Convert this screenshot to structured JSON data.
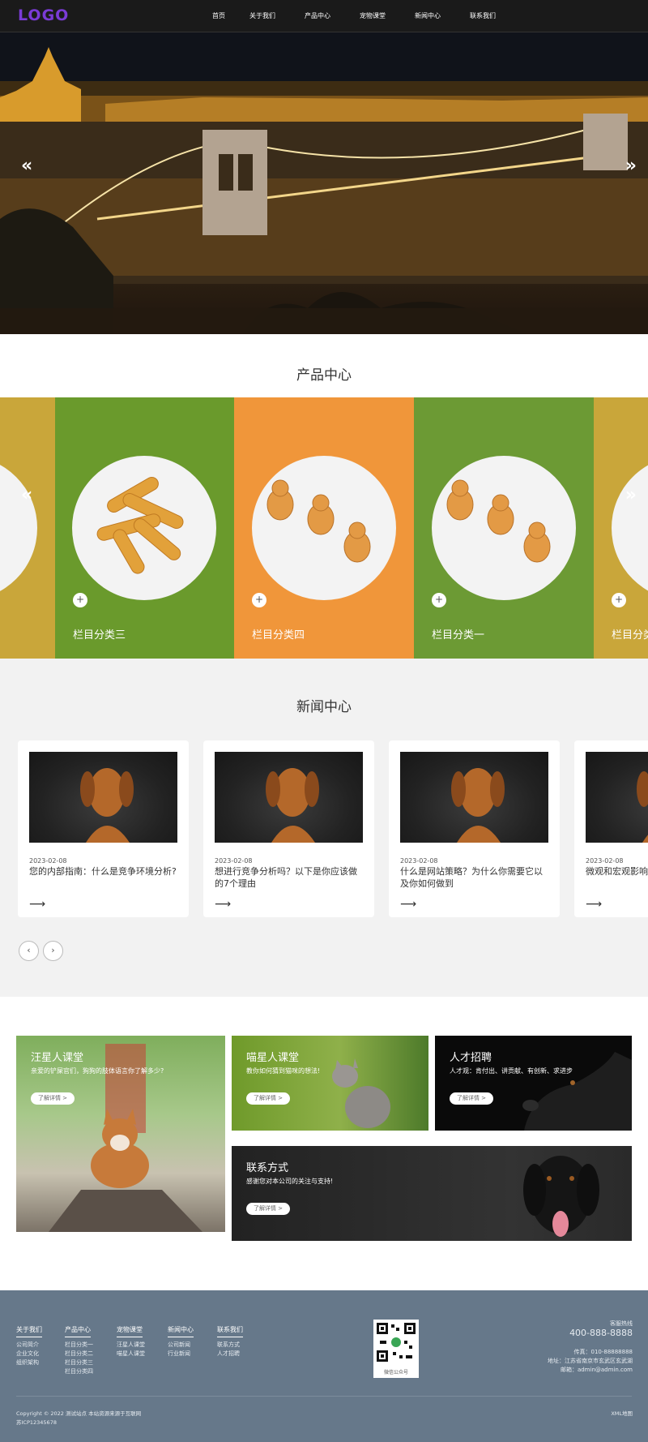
{
  "header": {
    "logo": "LOGO",
    "nav": [
      "首页",
      "关于我们",
      "产品中心",
      "宠物课堂",
      "新闻中心",
      "联系我们"
    ]
  },
  "hero": {
    "prev_icon": "«",
    "next_icon": "»"
  },
  "products": {
    "title": "产品中心",
    "prev_icon": "«",
    "next_icon": "»",
    "plus_icon": "+",
    "items": [
      {
        "label": "栏目分类三",
        "color": "#6a9a2c"
      },
      {
        "label": "栏目分类四",
        "color": "#f0963a"
      },
      {
        "label": "栏目分类一",
        "color": "#6c9a34"
      },
      {
        "label": "栏目分类二",
        "color": "#c9a63a"
      }
    ]
  },
  "news": {
    "title": "新闻中心",
    "arrow": "⟶",
    "prev": "‹",
    "next": "›",
    "items": [
      {
        "date": "2023-02-08",
        "title": "您的内部指南：什么是竞争环境分析?"
      },
      {
        "date": "2023-02-08",
        "title": "想进行竞争分析吗？以下是你应该做的7个理由"
      },
      {
        "date": "2023-02-08",
        "title": "什么是网站策略？为什么你需要它以及你如何做到"
      },
      {
        "date": "2023-02-08",
        "title": "微观和宏观影响"
      }
    ]
  },
  "banners": {
    "dog_class": {
      "title": "汪星人课堂",
      "desc": "亲爱的铲屎官们，狗狗的肢体语言你了解多少?",
      "button": "了解详情 >"
    },
    "cat_class": {
      "title": "喵星人课堂",
      "desc": "教你如何猜到猫咪的想法!",
      "button": "了解详情 >"
    },
    "jobs": {
      "title": "人才招聘",
      "desc": "人才观：肯付出、讲贡献、有创新、求进步",
      "button": "了解详情 >"
    },
    "contact": {
      "title": "联系方式",
      "desc": "感谢您对本公司的关注与支持!",
      "button": "了解详情 >"
    }
  },
  "footer": {
    "columns": [
      {
        "head": "关于我们",
        "links": [
          "公司简介",
          "企业文化",
          "组织架构"
        ]
      },
      {
        "head": "产品中心",
        "links": [
          "栏目分类一",
          "栏目分类二",
          "栏目分类三",
          "栏目分类四"
        ]
      },
      {
        "head": "宠物课堂",
        "links": [
          "汪星人课堂",
          "喵星人课堂"
        ]
      },
      {
        "head": "新闻中心",
        "links": [
          "公司新闻",
          "行业新闻"
        ]
      },
      {
        "head": "联系我们",
        "links": [
          "联系方式",
          "人才招聘"
        ]
      }
    ],
    "qr_caption": "微信公众号",
    "hotline_label": "客服热线",
    "hotline": "400-888-8888",
    "fax": "传真：010-88888888",
    "address": "地址：江苏省南京市玄武区玄武湖",
    "email": "邮箱：admin@admin.com",
    "copyright": "Copyright © 2022 测试站点 本站资源来源于互联网",
    "icp": "苏ICP12345678",
    "sitemap": "XML地图"
  }
}
